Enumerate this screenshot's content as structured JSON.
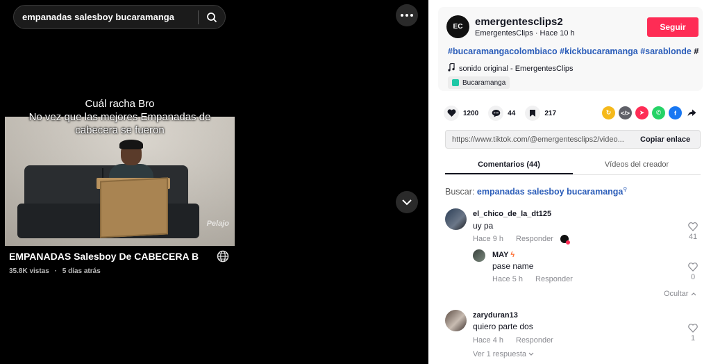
{
  "search": {
    "query": "empanadas salesboy bucaramanga"
  },
  "video": {
    "caption_line1": "Cuál racha Bro",
    "caption_line2": "No vez que las mejores Empanadas de",
    "caption_line3": "cabecera se fueron",
    "watermark": "Pelajo",
    "title": "EMPANADAS Salesboy De CABECERA B",
    "views": "35.8K vistas",
    "separator": "·",
    "age": "5 días atrás"
  },
  "author": {
    "avatar_text": "EC",
    "username": "emergentesclips2",
    "sub": "EmergentesClips · Hace 10 h",
    "follow_label": "Seguir"
  },
  "post": {
    "hashtags": "#bucaramangacolombiaco #kickbucaramanga #sarablonde",
    "hashtag_tail": "#",
    "music": "sonido original - EmergentesClips",
    "location": "Bucaramanga"
  },
  "stats": {
    "likes": "1200",
    "comments": "44",
    "saves": "217"
  },
  "share_icons": [
    "repost-icon",
    "embed-icon",
    "send-icon",
    "whatsapp-icon",
    "facebook-icon",
    "share-arrow-icon"
  ],
  "link": {
    "url": "https://www.tiktok.com/@emergentesclips2/video...",
    "copy_label": "Copiar enlace"
  },
  "tabs": {
    "comments": "Comentarios (44)",
    "creator_videos": "Vídeos del creador"
  },
  "search_result": {
    "label": "Buscar:",
    "query": "empanadas salesboy bucaramanga"
  },
  "comments": [
    {
      "user": "el_chico_de_la_dt125",
      "text": "uy pa",
      "time": "Hace 9 h",
      "reply": "Responder",
      "likes": "41"
    },
    {
      "user": "MAY",
      "text": "pase name",
      "time": "Hace 5 h",
      "reply": "Responder",
      "likes": "0"
    },
    {
      "user": "zaryduran13",
      "text": "quiero parte dos",
      "time": "Hace 4 h",
      "reply": "Responder",
      "likes": "1"
    }
  ],
  "hide_label": "Ocultar",
  "more_replies": "Ver 1 respuesta",
  "colors": {
    "accent": "#fe2c55",
    "link": "#2b5db9"
  }
}
